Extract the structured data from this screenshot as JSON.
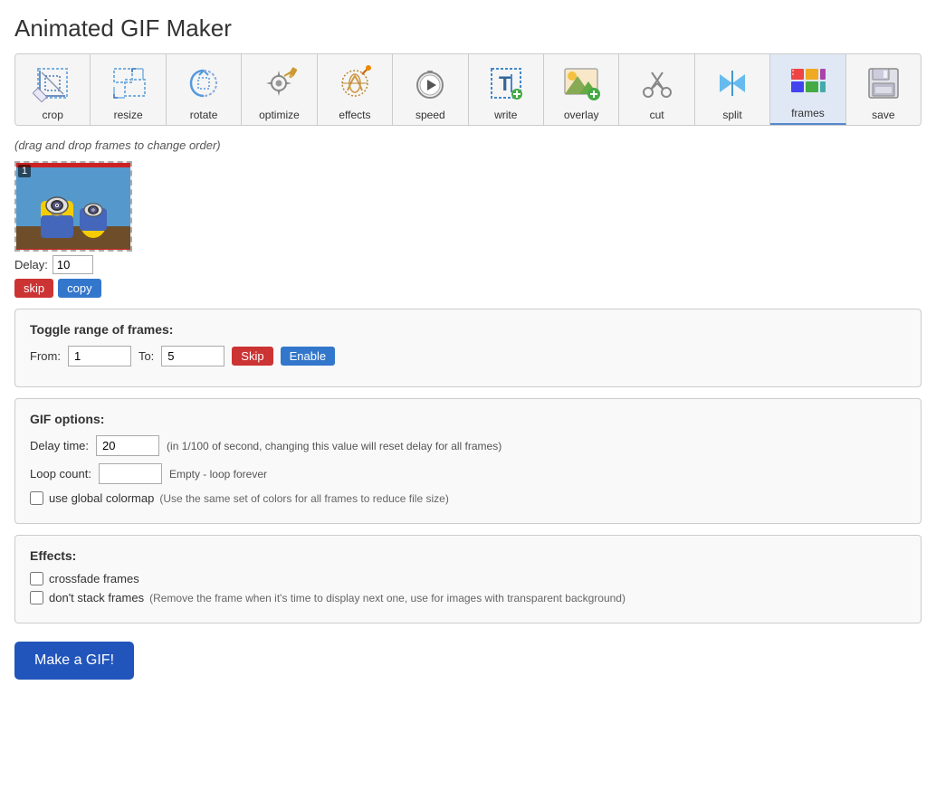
{
  "app": {
    "title": "Animated GIF Maker"
  },
  "toolbar": {
    "tools": [
      {
        "id": "crop",
        "label": "crop",
        "active": false
      },
      {
        "id": "resize",
        "label": "resize",
        "active": false
      },
      {
        "id": "rotate",
        "label": "rotate",
        "active": false
      },
      {
        "id": "optimize",
        "label": "optimize",
        "active": false
      },
      {
        "id": "effects",
        "label": "effects",
        "active": false
      },
      {
        "id": "speed",
        "label": "speed",
        "active": false
      },
      {
        "id": "write",
        "label": "write",
        "active": false
      },
      {
        "id": "overlay",
        "label": "overlay",
        "active": false
      },
      {
        "id": "cut",
        "label": "cut",
        "active": false
      },
      {
        "id": "split",
        "label": "split",
        "active": false
      },
      {
        "id": "frames",
        "label": "frames",
        "active": true
      },
      {
        "id": "save",
        "label": "save",
        "active": false
      }
    ]
  },
  "drag_hint": "(drag and drop frames to change order)",
  "frame": {
    "number": "1",
    "delay_label": "Delay:",
    "delay_value": "10",
    "skip_label": "skip",
    "copy_label": "copy"
  },
  "toggle_range": {
    "title": "Toggle range of frames:",
    "from_label": "From:",
    "from_value": "1",
    "to_label": "To:",
    "to_value": "5",
    "skip_label": "Skip",
    "enable_label": "Enable"
  },
  "gif_options": {
    "title": "GIF options:",
    "delay_time_label": "Delay time:",
    "delay_time_value": "20",
    "delay_time_hint": "in 1/100 of second, changing this value will reset delay for all frames",
    "loop_count_label": "Loop count:",
    "loop_count_value": "",
    "loop_count_hint": "Empty - loop forever",
    "global_colormap_label": "use global colormap",
    "global_colormap_hint": "(Use the same set of colors for all frames to reduce file size)"
  },
  "effects": {
    "title": "Effects:",
    "crossfade_label": "crossfade frames",
    "no_stack_label": "don't stack frames",
    "no_stack_hint": "(Remove the frame when it's time to display next one, use for images with transparent background)"
  },
  "make_gif_button": "Make a GIF!"
}
